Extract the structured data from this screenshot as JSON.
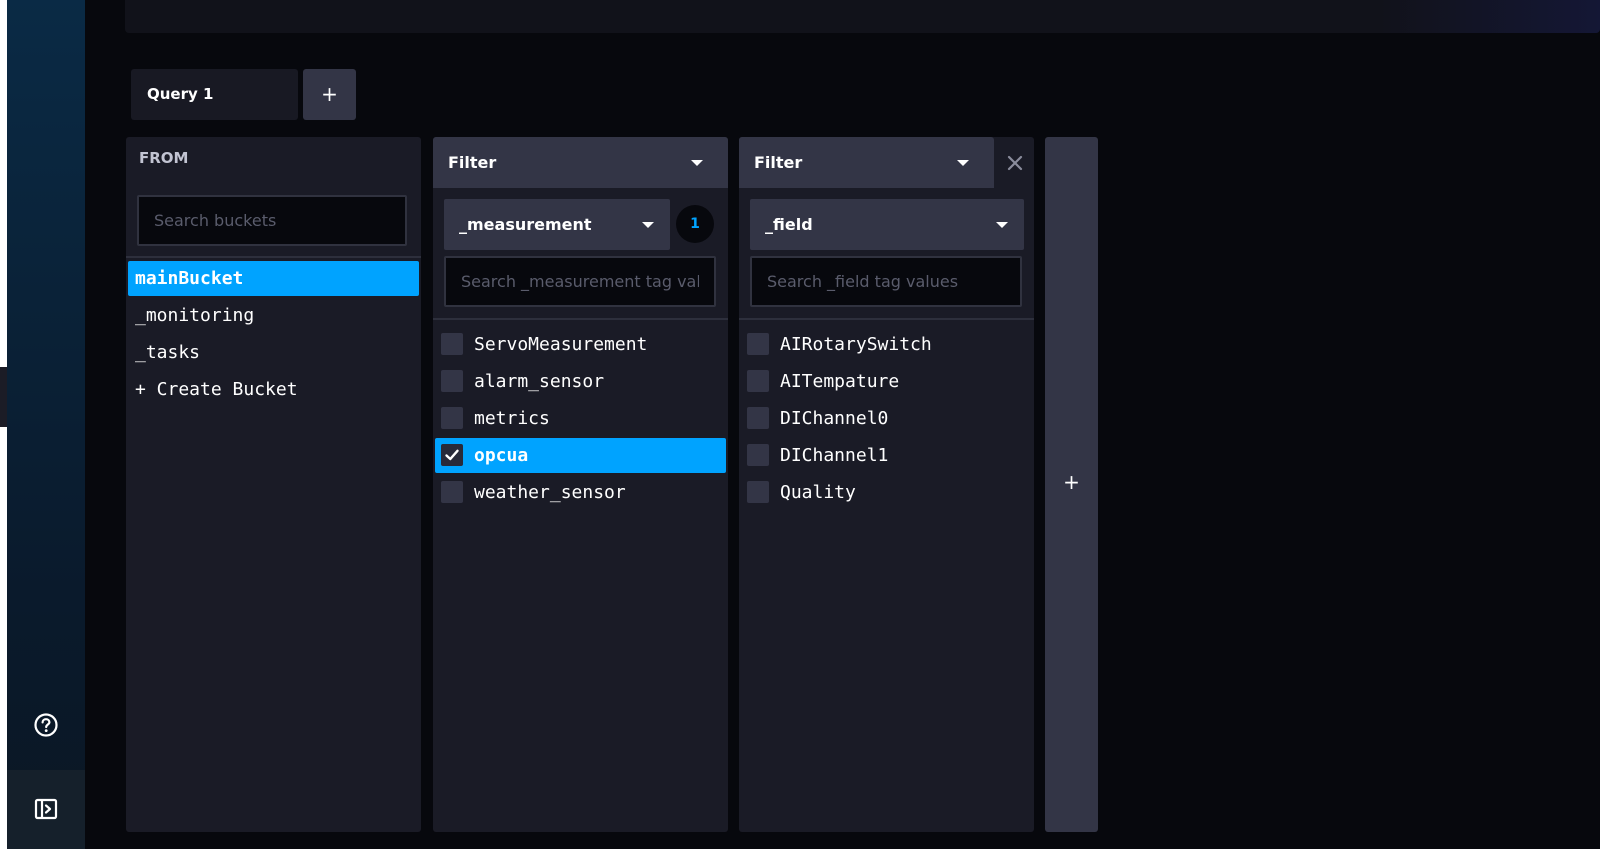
{
  "query_tabs": [
    {
      "label": "Query 1"
    }
  ],
  "add_query_label": "+",
  "from_panel": {
    "label": "FROM",
    "search_placeholder": "Search buckets",
    "buckets": [
      {
        "label": "mainBucket",
        "selected": true
      },
      {
        "label": "_monitoring",
        "selected": false
      },
      {
        "label": "_tasks",
        "selected": false
      },
      {
        "label": "+ Create Bucket",
        "selected": false
      }
    ]
  },
  "filters": [
    {
      "function_label": "Filter",
      "tag_key": "_measurement",
      "selected_count": "1",
      "search_placeholder": "Search _measurement tag values",
      "values": [
        {
          "label": "ServoMeasurement",
          "checked": false
        },
        {
          "label": "alarm_sensor",
          "checked": false
        },
        {
          "label": "metrics",
          "checked": false
        },
        {
          "label": "opcua",
          "checked": true
        },
        {
          "label": "weather_sensor",
          "checked": false
        }
      ]
    },
    {
      "function_label": "Filter",
      "tag_key": "_field",
      "search_placeholder": "Search _field tag values",
      "values": [
        {
          "label": "AIRotarySwitch",
          "checked": false
        },
        {
          "label": "AITempature",
          "checked": false
        },
        {
          "label": "DIChannel0",
          "checked": false
        },
        {
          "label": "DIChannel1",
          "checked": false
        },
        {
          "label": "Quality",
          "checked": false
        }
      ]
    }
  ],
  "add_filter_label": "+",
  "sidebar_icons": [
    "help-icon",
    "collapse-sidebar-icon"
  ],
  "colors": {
    "accent": "#00a3ff",
    "panel": "#1a1b26",
    "header": "#333546",
    "background": "#07080d"
  }
}
